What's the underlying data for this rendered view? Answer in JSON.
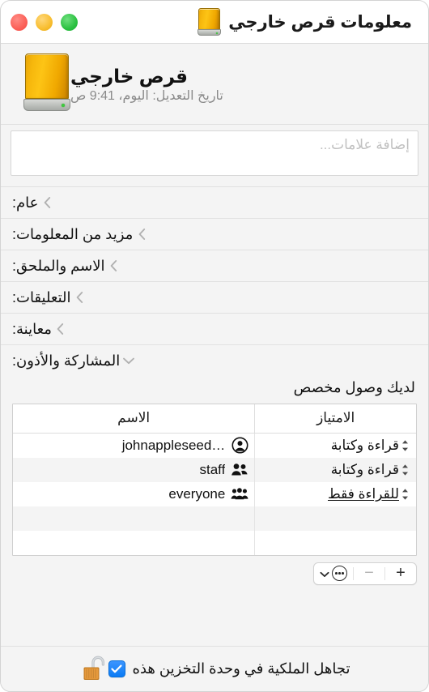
{
  "window": {
    "title": "معلومات قرص خارجي",
    "title_icon": "external-drive-icon",
    "traffic_lights": [
      {
        "name": "close",
        "color": "#fb5f57"
      },
      {
        "name": "minimize",
        "color": "#f8bd2e"
      },
      {
        "name": "zoom",
        "color": "#2ac040"
      }
    ]
  },
  "header": {
    "icon": "external-drive-icon",
    "name": "قرص خارجي",
    "modified": "تاريخ التعديل: اليوم، 9:41 ص"
  },
  "tags": {
    "value": "",
    "placeholder": "إضافة علامات..."
  },
  "sections": [
    {
      "label": "عام:",
      "expanded": false,
      "icon": "chevron-left-icon"
    },
    {
      "label": "مزيد من المعلومات:",
      "expanded": false,
      "icon": "chevron-left-icon"
    },
    {
      "label": "الاسم والملحق:",
      "expanded": false,
      "icon": "chevron-left-icon"
    },
    {
      "label": "التعليقات:",
      "expanded": false,
      "icon": "chevron-left-icon"
    },
    {
      "label": "معاينة:",
      "expanded": false,
      "icon": "chevron-left-icon"
    }
  ],
  "sharing": {
    "label": "المشاركة والأذون:",
    "expanded": true,
    "icon": "chevron-down-icon",
    "status": "لديك وصول مخصص",
    "table": {
      "columns": [
        "الاسم",
        "الامتياز"
      ],
      "rows": [
        {
          "who_icon": "single-person-icon",
          "name": "johnappleseed…",
          "privilege": "قراءة وكتابة",
          "underlined": false
        },
        {
          "who_icon": "two-person-group-icon",
          "name": "staff",
          "privilege": "قراءة وكتابة",
          "underlined": false
        },
        {
          "who_icon": "three-person-group-icon",
          "name": "everyone",
          "privilege": "للقراءة فقط",
          "underlined": true
        }
      ],
      "empty_rows": 2
    },
    "toolbar": {
      "add_label": "+",
      "remove_label": "−",
      "action_icon": "ellipsis-circle-icon",
      "action_chevron": "chevron-down-icon"
    }
  },
  "footer": {
    "lock_icon": "padlock-open-icon",
    "lock_state": "unlocked",
    "checkbox": {
      "checked": true,
      "label": "تجاهل الملكية في وحدة التخزين هذه"
    }
  },
  "colors": {
    "accent": "#0a7bf4",
    "drive_body": "#f0a800",
    "window_bg": "#f4f4f4",
    "row_alt": "#f4f4f4"
  }
}
